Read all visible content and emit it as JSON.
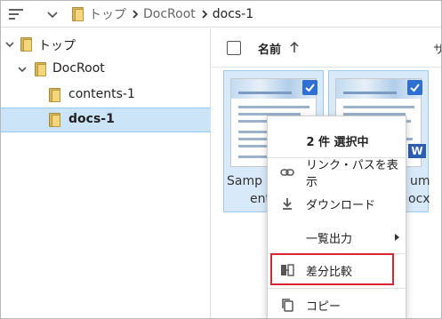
{
  "breadcrumb": {
    "items": [
      "トップ",
      "DocRoot",
      "docs-1"
    ]
  },
  "tree": {
    "items": [
      {
        "label": "トップ",
        "level": 0,
        "expanded": true
      },
      {
        "label": "DocRoot",
        "level": 1,
        "expanded": true
      },
      {
        "label": "contents-1",
        "level": 2
      },
      {
        "label": "docs-1",
        "level": 2,
        "selected": true
      }
    ]
  },
  "file_list": {
    "name_header": "名前",
    "second_header": "サ",
    "files": [
      {
        "name_line1": "Samp",
        "name_line2": "ent",
        "selected": true
      },
      {
        "name_line1": "um",
        "name_line2": "ocx",
        "selected": true,
        "type_badge": "W"
      }
    ]
  },
  "context_menu": {
    "title": "2 件 選択中",
    "items": [
      {
        "label": "リンク・パスを表示",
        "icon": "link-icon"
      },
      {
        "label": "ダウンロード",
        "icon": "download-icon"
      },
      {
        "label": "一覧出力",
        "icon": "",
        "has_submenu": true
      },
      {
        "label": "差分比較",
        "icon": "compare-icon",
        "highlighted": true
      },
      {
        "label": "コピー",
        "icon": "copy-icon"
      }
    ]
  },
  "colors": {
    "selection_bg": "#cce4f7",
    "tile_bg": "#d8eaf9",
    "checkbox_blue": "#2f6fd1",
    "highlight_red": "#d9252f",
    "folder_yellow": "#f3d77a"
  }
}
